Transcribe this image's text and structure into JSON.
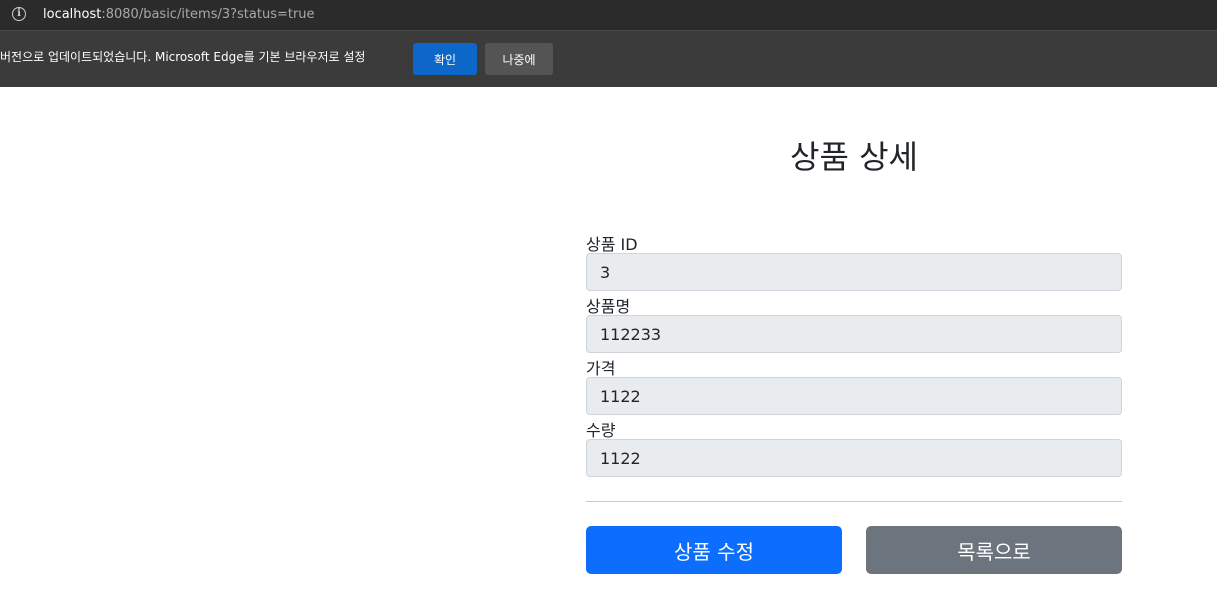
{
  "browser": {
    "url_host": "localhost",
    "url_rest": ":8080/basic/items/3?status=true",
    "infobar": {
      "message": "버전으로 업데이트되었습니다. Microsoft Edge를 기본 브라우저로 설정",
      "confirm_label": "확인",
      "later_label": "나중에"
    }
  },
  "page": {
    "title": "상품 상세",
    "fields": [
      {
        "label": "상품 ID",
        "value": "3"
      },
      {
        "label": "상품명",
        "value": "112233"
      },
      {
        "label": "가격",
        "value": "1122"
      },
      {
        "label": "수량",
        "value": "1122"
      }
    ],
    "edit_button": "상품 수정",
    "list_button": "목록으로"
  },
  "colors": {
    "primary": "#0d6efd",
    "secondary": "#6c757d",
    "readonly_bg": "#e9ecef",
    "edge_confirm": "#0c67c9"
  }
}
